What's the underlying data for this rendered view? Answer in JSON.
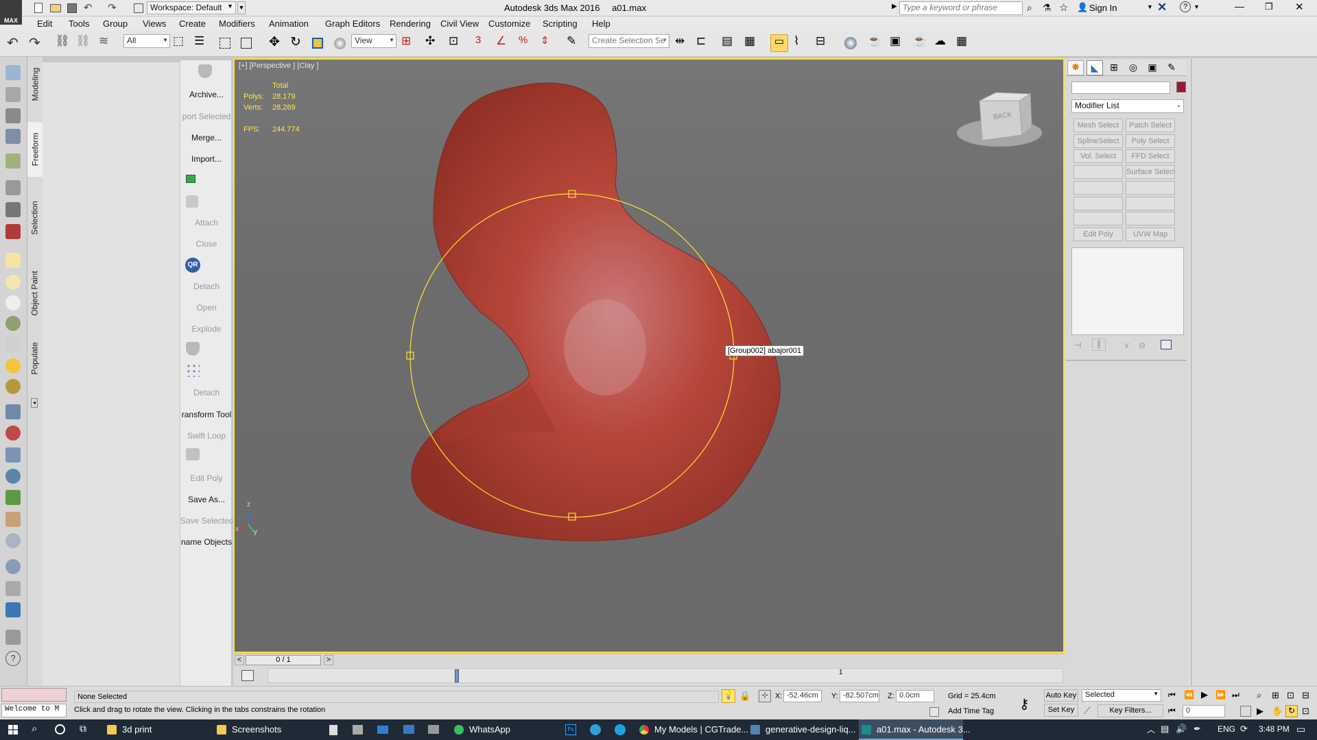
{
  "title": {
    "workspace": "Workspace: Default",
    "app_title": "Autodesk 3ds Max 2016",
    "file_name": "a01.max",
    "search_placeholder": "Type a keyword or phrase",
    "sign_in": "Sign In",
    "logo": "MAX"
  },
  "menu": [
    "Edit",
    "Tools",
    "Group",
    "Views",
    "Create",
    "Modifiers",
    "Animation",
    "Graph Editors",
    "Rendering",
    "Civil View",
    "Customize",
    "Scripting",
    "Help"
  ],
  "toolbar": {
    "filter_value": "All",
    "ref_coord_value": "View",
    "selection_set_placeholder": "Create Selection Se"
  },
  "ribbon_tabs": [
    "Modeling",
    "Freeform",
    "Selection",
    "Object Paint",
    "Populate"
  ],
  "ribbon_panel": {
    "archive": "Archive...",
    "export_selected": "port Selected",
    "merge": "Merge...",
    "import": "Import...",
    "attach": "Attach",
    "close": "Close",
    "detach1": "Detach",
    "open": "Open",
    "explode": "Explode",
    "detach2": "Detach",
    "transform_tool": "ransform Tool",
    "swift_loop": "Swift Loop",
    "edit_poly": "Edit Poly",
    "save_as": "Save As...",
    "save_selected": "Save Selected",
    "rename_objects": "name Objects",
    "qr_badge": "QR"
  },
  "viewport": {
    "label": "[+] [Perspective ] [Clay ]",
    "stats_total": "Total",
    "polys_label": "Polys:",
    "polys_value": "28,179",
    "verts_label": "Verts:",
    "verts_value": "28,269",
    "fps_label": "FPS:",
    "fps_value": "244.774",
    "tooltip": "[Group002] abajor001",
    "viewcube_label": "BACK",
    "axis_z": "z",
    "axis_x": "x",
    "axis_y": "y",
    "object_color": "#b8463a",
    "selection_color": "#ffe32c"
  },
  "command_panel": {
    "modifier_list": "Modifier List",
    "color_swatch": "#9a1836",
    "buttons": [
      [
        "Mesh Select",
        "Patch Select"
      ],
      [
        "SplineSelect",
        "Poly Select"
      ],
      [
        "Vol. Select",
        "FFD Select"
      ],
      [
        "",
        "Surface Select"
      ],
      [
        "",
        ""
      ],
      [
        "",
        ""
      ],
      [
        "",
        ""
      ],
      [
        "Edit Poly",
        "UVW Map"
      ]
    ]
  },
  "timeslider": {
    "frame": "0 / 1",
    "prev": "<",
    "next": ">",
    "tick": "1"
  },
  "status": {
    "selected": "None Selected",
    "prompt": "Click and drag to rotate the view.  Clicking in the tabs constrains the rotation",
    "welcome": "Welcome to M",
    "x_label": "X:",
    "x_value": "-52.46cm",
    "y_label": "Y:",
    "y_value": "-82.507cm",
    "z_label": "Z:",
    "z_value": "0.0cm",
    "grid": "Grid = 25.4cm",
    "add_time_tag": "Add Time Tag",
    "auto_key": "Auto Key",
    "set_key": "Set Key",
    "key_mode": "Selected",
    "key_filters": "Key Filters...",
    "frame_value": "0"
  },
  "taskbar": {
    "items": [
      "3d print",
      "Screenshots",
      "WhatsApp",
      "My Models | CGTrade...",
      "generative-design-liq...",
      "a01.max - Autodesk 3..."
    ],
    "lang": "ENG",
    "time": "3:48 PM"
  }
}
